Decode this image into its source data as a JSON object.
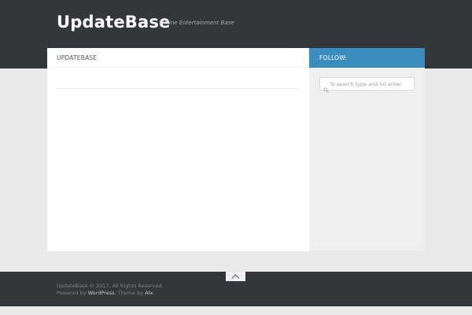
{
  "header": {
    "site_title": "UpdateBase",
    "site_description": "Online Entertainment Base"
  },
  "content": {
    "title": "UPDATEBASE"
  },
  "sidebar": {
    "follow_label": "FOLLOW:",
    "search_placeholder": "To search type and hit enter",
    "search_icon": "search-icon"
  },
  "footer": {
    "copyright": "UpdateBase © 2017. All Rights Reserved.",
    "powered_prefix": "Powered by ",
    "wordpress_link": "WordPress",
    "theme_middle": ". Theme by ",
    "theme_link": "Alx",
    "theme_suffix": ".",
    "back_to_top_icon": "chevron-up-icon"
  },
  "colors": {
    "header_bg": "#33363b",
    "accent": "#3b8dbd",
    "page_bg": "#e9e9e9"
  }
}
